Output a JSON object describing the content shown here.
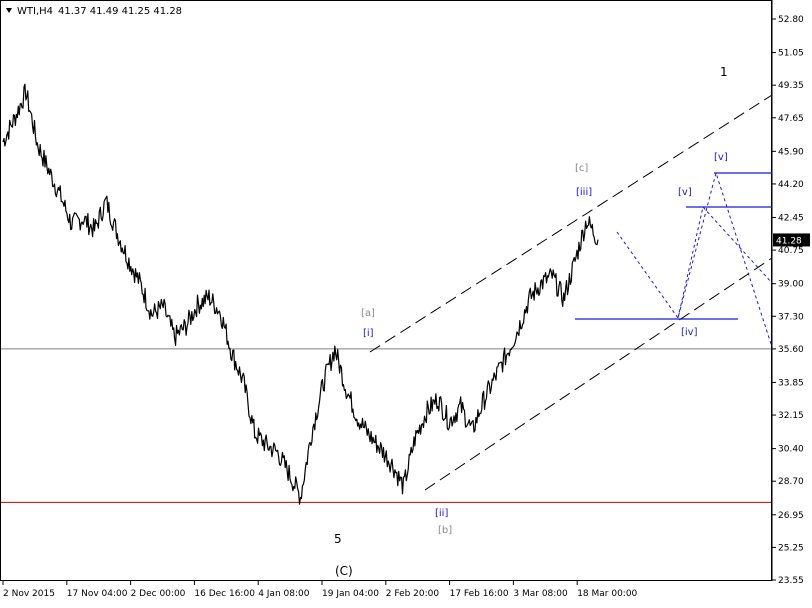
{
  "header": {
    "symbol": "WTI,H4",
    "ohlc": "41.37 41.49 41.25 41.28",
    "menu_icon": "triangle-down-icon"
  },
  "colors": {
    "price": "#000000",
    "support_line": "#cc0000",
    "hline": "#808080",
    "projection": "#1a1ad6",
    "channel": "#000000",
    "current_label_bg": "#000000",
    "current_label_fg": "#ffffff"
  },
  "chart_data": {
    "type": "line",
    "instrument": "WTI",
    "timeframe": "H4",
    "current_price": "41.28",
    "y_ticks": [
      "52.80",
      "51.05",
      "49.35",
      "47.65",
      "45.90",
      "44.20",
      "42.45",
      "40.75",
      "39.00",
      "37.30",
      "35.60",
      "33.85",
      "32.15",
      "30.40",
      "28.70",
      "26.95",
      "25.25",
      "23.55"
    ],
    "ylim": [
      23.55,
      52.8
    ],
    "x_ticks": [
      "2 Nov 2015",
      "17 Nov 04:00",
      "2 Dec 00:00",
      "16 Dec 16:00",
      "4 Jan 08:00",
      "19 Jan 04:00",
      "2 Feb 20:00",
      "17 Feb 16:00",
      "3 Mar 08:00",
      "18 Mar 00:00"
    ],
    "series": [
      {
        "x": [
          "2 Nov 2015",
          "4 Nov",
          "7 Nov",
          "10 Nov",
          "13 Nov",
          "17 Nov",
          "20 Nov",
          "24 Nov",
          "27 Nov",
          "2 Dec",
          "5 Dec",
          "8 Dec",
          "11 Dec",
          "14 Dec",
          "18 Dec",
          "21 Dec",
          "24 Dec",
          "28 Dec",
          "30 Dec",
          "4 Jan",
          "6 Jan",
          "8 Jan",
          "11 Jan",
          "13 Jan",
          "15 Jan",
          "18 Jan",
          "20 Jan",
          "22 Jan",
          "25 Jan",
          "27 Jan",
          "29 Jan",
          "1 Feb",
          "3 Feb",
          "5 Feb",
          "8 Feb",
          "10 Feb",
          "11 Feb",
          "14 Feb",
          "17 Feb",
          "19 Feb",
          "22 Feb",
          "24 Feb",
          "26 Feb",
          "29 Feb",
          "2 Mar",
          "4 Mar",
          "7 Mar",
          "9 Mar",
          "11 Mar",
          "14 Mar",
          "16 Mar",
          "18 Mar",
          "21 Mar"
        ],
        "values": [
          46.4,
          47.6,
          49.0,
          46.3,
          44.9,
          43.6,
          42.1,
          42.4,
          41.8,
          43.3,
          41.6,
          40.2,
          39.0,
          37.4,
          37.8,
          36.2,
          36.8,
          37.9,
          38.3,
          37.5,
          35.4,
          33.9,
          31.2,
          30.6,
          30.2,
          29.1,
          27.9,
          31.3,
          33.8,
          35.6,
          33.5,
          32.0,
          31.1,
          30.4,
          29.6,
          28.4,
          30.9,
          32.3,
          33.0,
          31.8,
          32.6,
          31.3,
          32.9,
          34.1,
          35.3,
          36.6,
          38.2,
          39.0,
          39.4,
          38.2,
          40.2,
          42.3,
          41.3
        ]
      }
    ],
    "annotations": {
      "support_level": 27.6,
      "horizontal_level": 35.6,
      "wave_labels": [
        {
          "text": "1",
          "class": "black"
        },
        {
          "text": "5",
          "class": "black"
        },
        {
          "text": "(C)",
          "class": "black"
        },
        {
          "text": "[a]",
          "class": "gray"
        },
        {
          "text": "[i]",
          "class": "blue"
        },
        {
          "text": "[ii]",
          "class": "blue"
        },
        {
          "text": "[b]",
          "class": "gray"
        },
        {
          "text": "[c]",
          "class": "gray"
        },
        {
          "text": "[iii]",
          "class": "blue"
        },
        {
          "text": "[iv]",
          "class": "blue"
        },
        {
          "text": "[v]",
          "class": "blue"
        },
        {
          "text": "[v]",
          "class": "blue"
        }
      ]
    }
  }
}
